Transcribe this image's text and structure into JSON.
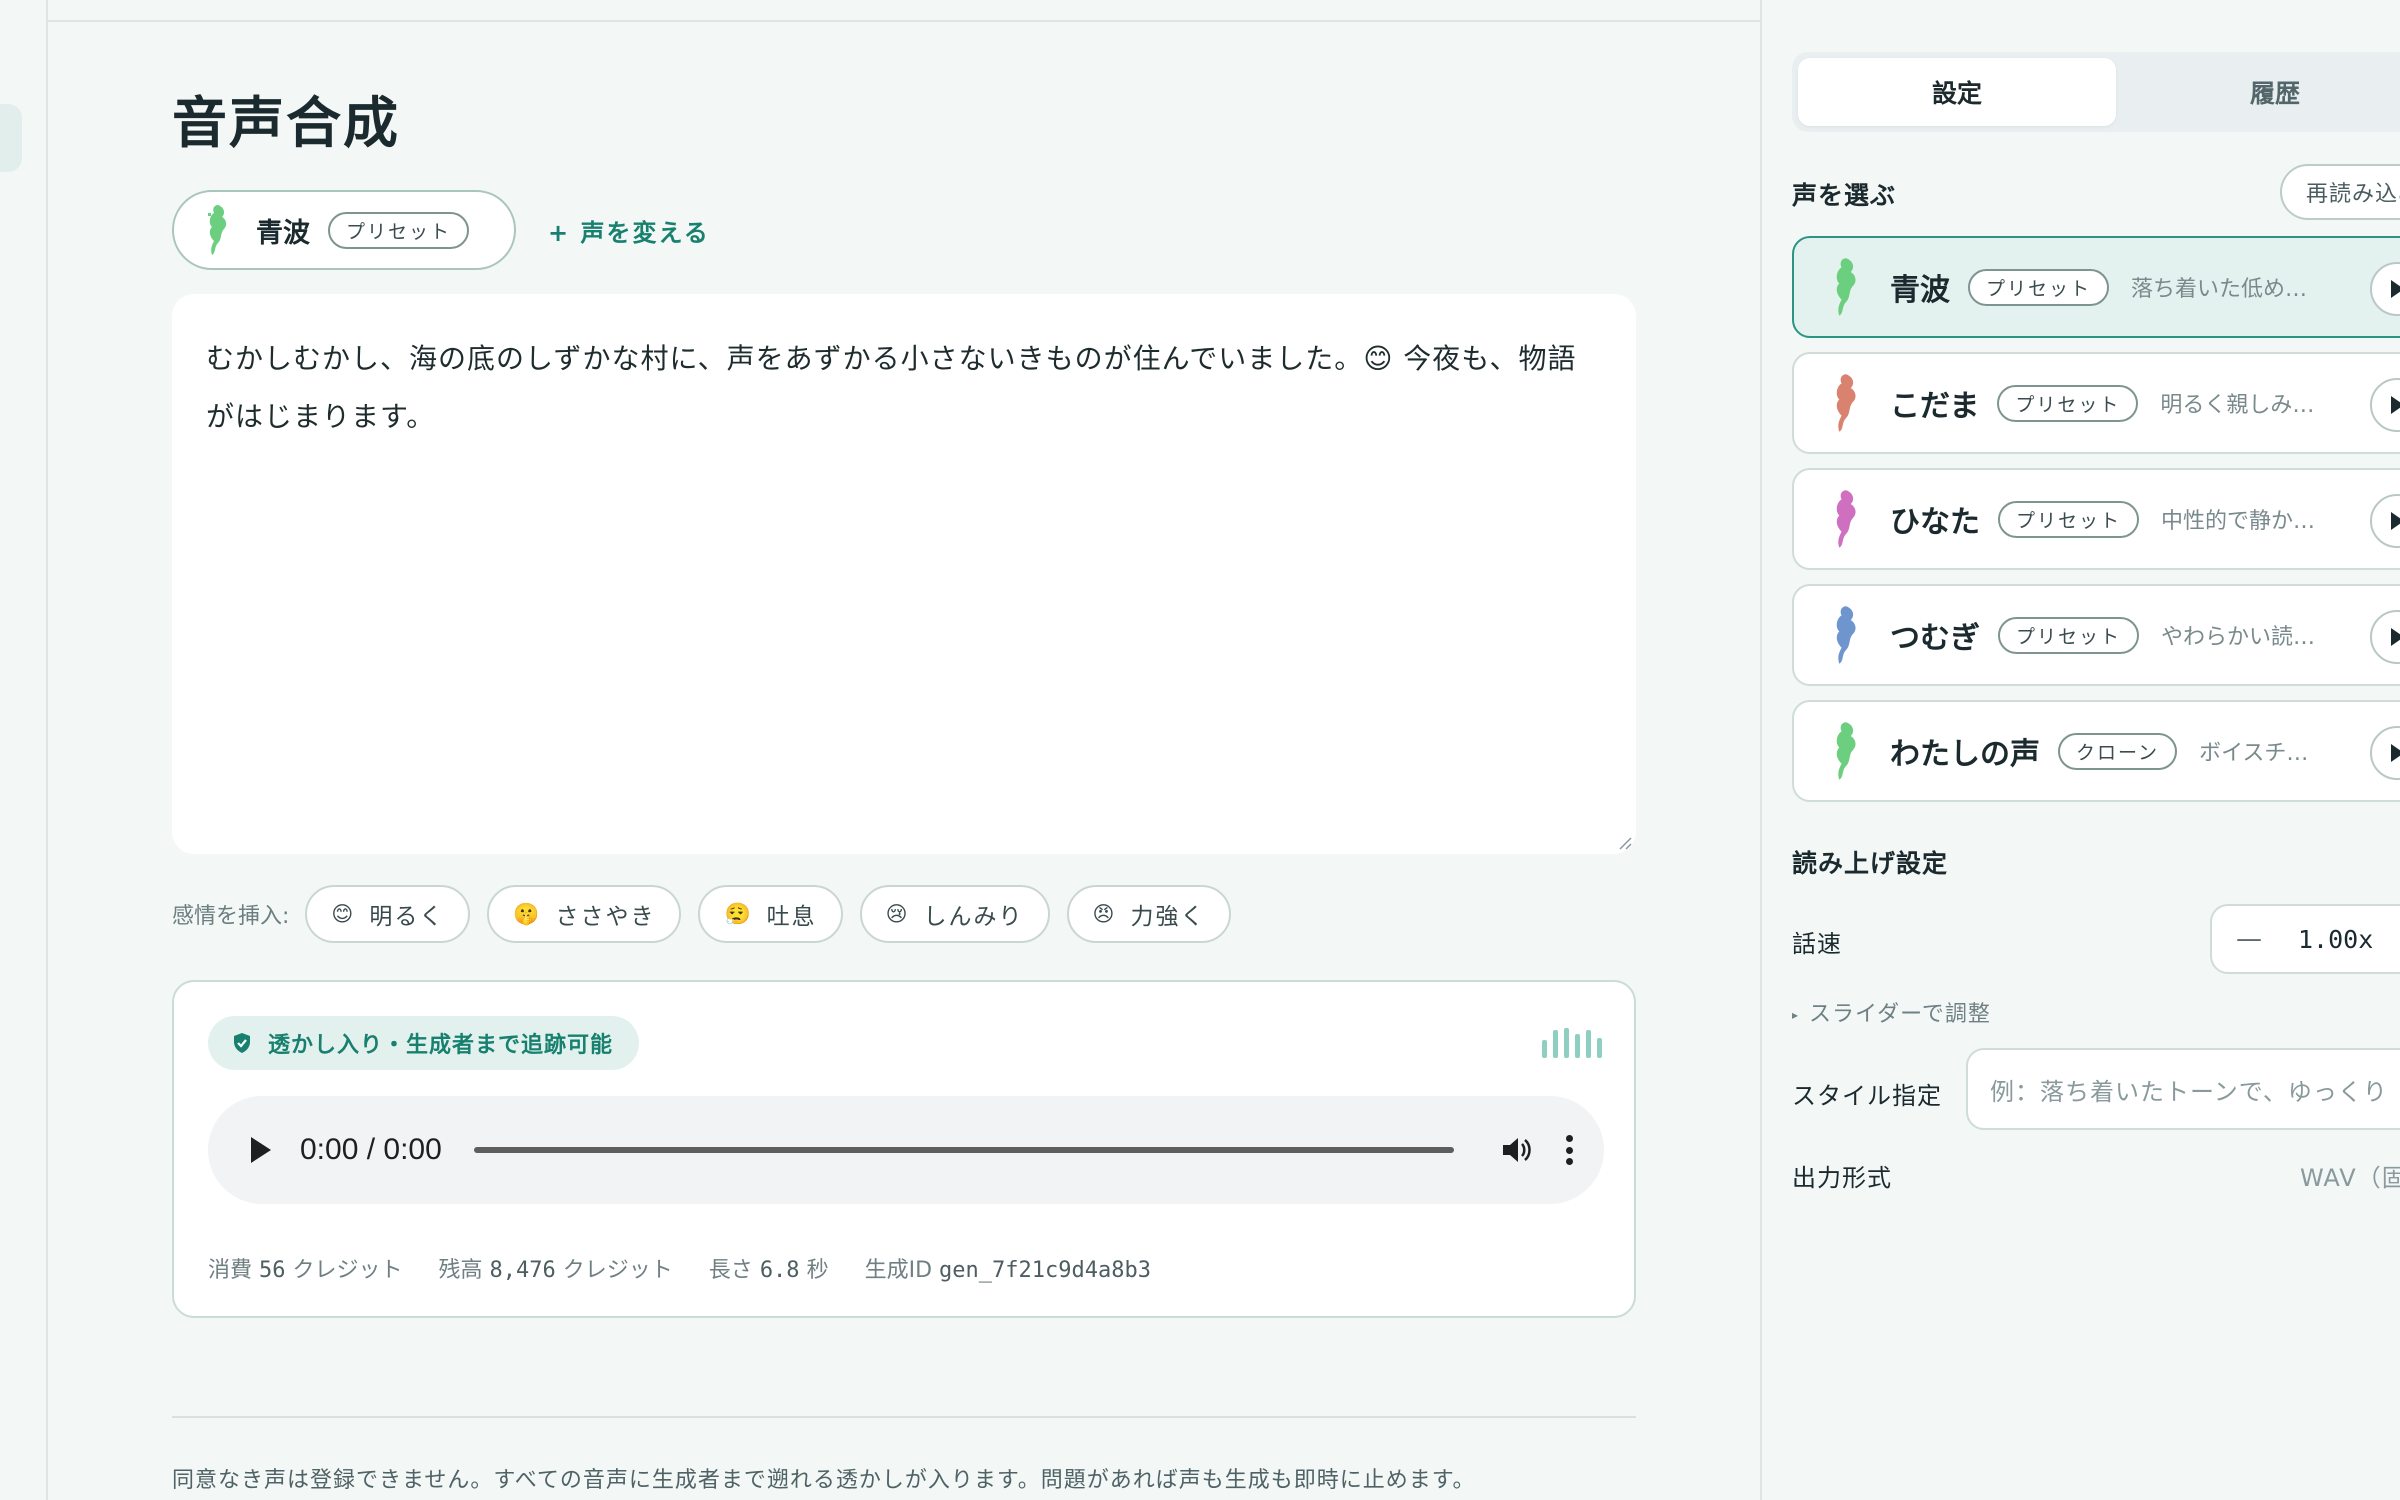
{
  "page_title": "音声合成",
  "current_voice": {
    "name": "青波",
    "badge": "プリセット"
  },
  "change_voice_label": "+ 声を変える",
  "script_text": "むかしむかし、海の底のしずかな村に、声をあずかる小さないきものが住んでいました。😊 今夜も、物語がはじまります。",
  "emotions": {
    "label": "感情を挿入:",
    "items": [
      {
        "emoji": "😊",
        "label": "明るく"
      },
      {
        "emoji": "🤫",
        "label": "ささやき"
      },
      {
        "emoji": "😮‍💨",
        "label": "吐息"
      },
      {
        "emoji": "😢",
        "label": "しんみり"
      },
      {
        "emoji": "😠",
        "label": "力強く"
      }
    ]
  },
  "result": {
    "watermark_label": "透かし入り・生成者まで追跡可能",
    "player_time": "0:00 / 0:00",
    "meta": {
      "cost_label": "消費",
      "cost_value": "56",
      "cost_unit": "クレジット",
      "balance_label": "残高",
      "balance_value": "8,476",
      "balance_unit": "クレジット",
      "length_label": "長さ",
      "length_value": "6.8",
      "length_unit": "秒",
      "gen_id_label": "生成ID",
      "gen_id_value": "gen_7f21c9d4a8b3"
    }
  },
  "footer_note": "同意なき声は登録できません。すべての音声に生成者まで遡れる透かしが入ります。問題があれば声も生成も即時に止めます。",
  "sidebar": {
    "tabs": [
      "設定",
      "履歴"
    ],
    "voices_title": "声を選ぶ",
    "reload_label": "再読み込み",
    "voices": [
      {
        "name": "青波",
        "badge": "プリセット",
        "desc": "落ち着いた低め…",
        "color": "#6ccf7f",
        "selected": true
      },
      {
        "name": "こだま",
        "badge": "プリセット",
        "desc": "明るく親しみ…",
        "color": "#d9826f",
        "selected": false
      },
      {
        "name": "ひなた",
        "badge": "プリセット",
        "desc": "中性的で静か…",
        "color": "#cf6fc0",
        "selected": false
      },
      {
        "name": "つむぎ",
        "badge": "プリセット",
        "desc": "やわらかい読…",
        "color": "#6f95cf",
        "selected": false
      },
      {
        "name": "わたしの声",
        "badge": "クローン",
        "desc": "ボイスチ…",
        "color": "#6ccf7f",
        "selected": false
      }
    ],
    "reading_title": "読み上げ設定",
    "speed_label": "話速",
    "speed_minus": "—",
    "speed_value": "1.00x",
    "slider_toggle": "スライダーで調整",
    "style_label": "スタイル指定",
    "style_placeholder": "例：落ち着いたトーンで、ゆっくり",
    "output_label": "出力形式",
    "output_value": "WAV（固定）"
  },
  "colors": {
    "accent": "#17806f",
    "accent_bg": "#e3f1ee",
    "border": "#cfdcda"
  }
}
